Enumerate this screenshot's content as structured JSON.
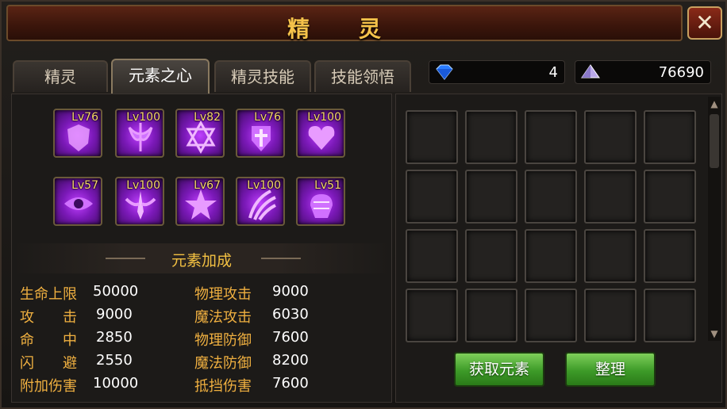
{
  "window": {
    "title": "精 灵",
    "close_icon": "close-x-icon"
  },
  "tabs": [
    {
      "label": "精灵"
    },
    {
      "label": "元素之心",
      "active": true
    },
    {
      "label": "精灵技能"
    },
    {
      "label": "技能领悟"
    }
  ],
  "currency": {
    "gems": {
      "icon": "diamond-icon",
      "value": "4"
    },
    "crystal": {
      "icon": "crystal-icon",
      "value": "76690"
    }
  },
  "elements": [
    {
      "level": "Lv76",
      "icon": "shield-wing-icon"
    },
    {
      "level": "Lv100",
      "icon": "axe-icon"
    },
    {
      "level": "Lv82",
      "icon": "hexagram-icon"
    },
    {
      "level": "Lv76",
      "icon": "cross-shield-icon"
    },
    {
      "level": "Lv100",
      "icon": "heart-icon"
    },
    {
      "level": "Lv57",
      "icon": "eye-icon"
    },
    {
      "level": "Lv100",
      "icon": "sword-wing-icon"
    },
    {
      "level": "Lv67",
      "icon": "star-burst-icon"
    },
    {
      "level": "Lv100",
      "icon": "claw-icon"
    },
    {
      "level": "Lv51",
      "icon": "fist-icon"
    }
  ],
  "bonus": {
    "header": "元素加成",
    "left": [
      {
        "label": "生命上限",
        "value": "50000"
      },
      {
        "label": "攻　　击",
        "value": "9000"
      },
      {
        "label": "命　　中",
        "value": "2850"
      },
      {
        "label": "闪　　避",
        "value": "2550"
      },
      {
        "label": "附加伤害",
        "value": "10000"
      }
    ],
    "right": [
      {
        "label": "物理攻击",
        "value": "9000"
      },
      {
        "label": "魔法攻击",
        "value": "6030"
      },
      {
        "label": "物理防御",
        "value": "7600"
      },
      {
        "label": "魔法防御",
        "value": "8200"
      },
      {
        "label": "抵挡伤害",
        "value": "7600"
      }
    ]
  },
  "buttons": {
    "get_element": "获取元素",
    "sort": "整理"
  },
  "colors": {
    "accent_gold": "#f0b040",
    "button_green": "#4aa82e",
    "element_purple": "#9b2ee0"
  }
}
